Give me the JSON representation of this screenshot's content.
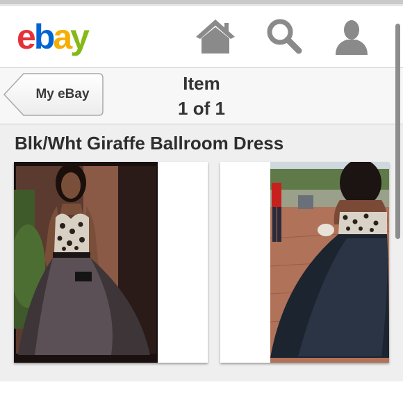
{
  "brand": {
    "logo_letters": [
      "e",
      "b",
      "a",
      "y"
    ]
  },
  "header": {
    "icons": [
      "home-icon",
      "search-icon",
      "user-icon"
    ]
  },
  "navbar": {
    "back_label": "My eBay",
    "title_line1": "Item",
    "title_line2": "1 of 1"
  },
  "item": {
    "title": "Blk/Wht Giraffe Ballroom Dress",
    "photos": [
      "dress-front-photo",
      "dress-back-photo"
    ]
  },
  "colors": {
    "logo_e": "#e53238",
    "logo_b": "#0064d2",
    "logo_a": "#f5af02",
    "logo_y": "#86b817",
    "icon_gray": "#8a8a8a"
  }
}
